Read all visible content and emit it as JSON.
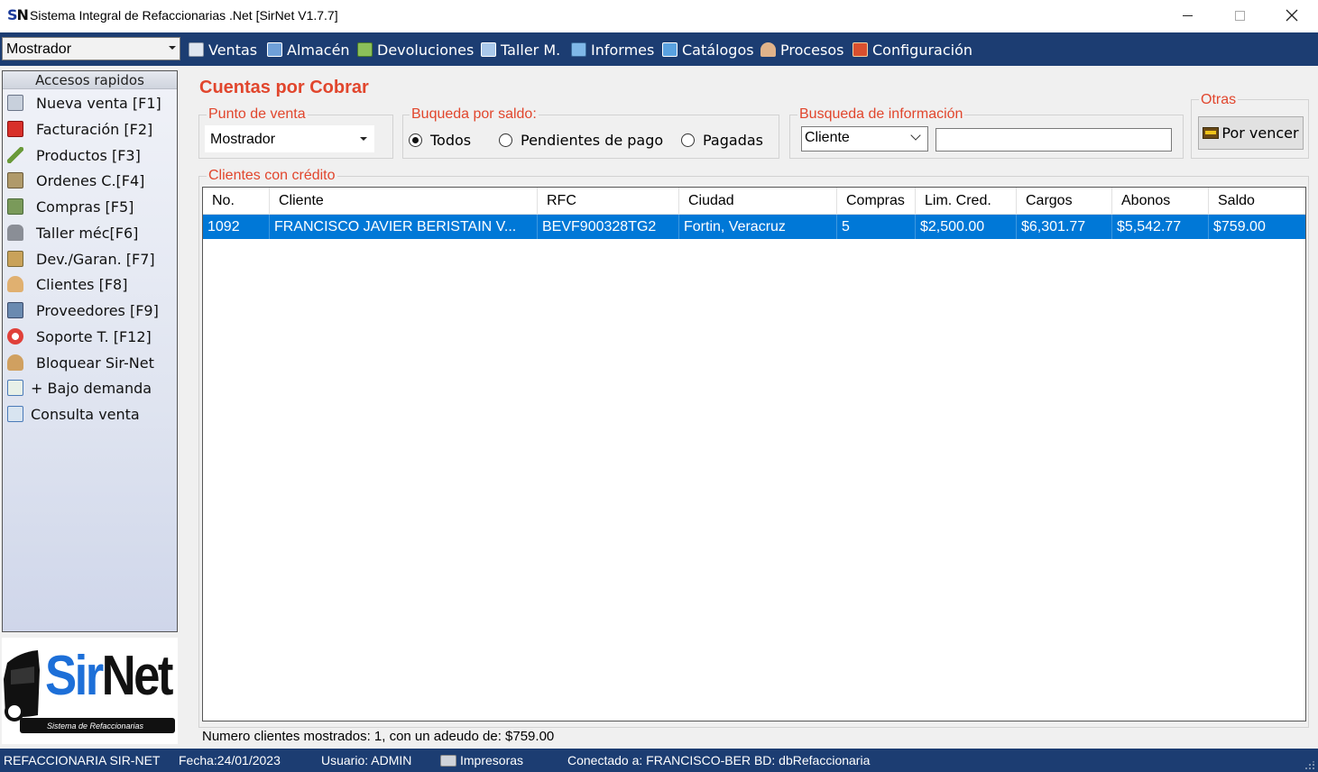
{
  "window": {
    "logo_s": "S",
    "logo_n": "N",
    "title": "Sistema Integral de Refaccionarias .Net [SirNet V1.7.7]"
  },
  "menubar": {
    "pos_select": "Mostrador",
    "items": [
      {
        "label": "Ventas",
        "icon": "ventas-icon",
        "color": "#dfe6f0"
      },
      {
        "label": "Almacén",
        "icon": "almacen-icon",
        "color": "#6fa0d8"
      },
      {
        "label": "Devoluciones",
        "icon": "devoluciones-icon",
        "color": "#8bbf5a"
      },
      {
        "label": "Taller M.",
        "icon": "taller-icon",
        "color": "#a9c8ea"
      },
      {
        "label": "Informes",
        "icon": "informes-icon",
        "color": "#7fb8e8"
      },
      {
        "label": "Catálogos",
        "icon": "catalogos-icon",
        "color": "#5aa2e0"
      },
      {
        "label": "Procesos",
        "icon": "procesos-icon",
        "color": "#e0b38a"
      },
      {
        "label": "Configuración",
        "icon": "configuracion-icon",
        "color": "#d9502f"
      }
    ]
  },
  "sidebar": {
    "header": "Accesos rapidos",
    "items": [
      {
        "label": "Nueva venta [F1]",
        "icon": "nueva-venta-icon",
        "color": "#c8d0dc"
      },
      {
        "label": "Facturación [F2]",
        "icon": "pdf-icon",
        "color": "#d8302a"
      },
      {
        "label": "Productos [F3]",
        "icon": "productos-icon",
        "color": "#6a9a3a"
      },
      {
        "label": "Ordenes C.[F4]",
        "icon": "ordenes-icon",
        "color": "#b09a6a"
      },
      {
        "label": "Compras [F5]",
        "icon": "compras-icon",
        "color": "#7a9a5a"
      },
      {
        "label": "Taller méc[F6]",
        "icon": "taller-mec-icon",
        "color": "#8a8e96"
      },
      {
        "label": "Dev./Garan. [F7]",
        "icon": "devgaran-icon",
        "color": "#c9a25a"
      },
      {
        "label": "Clientes [F8]",
        "icon": "clientes-icon",
        "color": "#e0b070"
      },
      {
        "label": "Proveedores [F9]",
        "icon": "proveedores-icon",
        "color": "#6a8ab0"
      },
      {
        "label": "Soporte T. [F12]",
        "icon": "soporte-icon",
        "color": "#e0403a"
      },
      {
        "label": "Bloquear Sir-Net",
        "icon": "bloquear-icon",
        "color": "#d0a060"
      },
      {
        "label": "+ Bajo demanda",
        "icon": "bajo-demanda-icon",
        "color": "#4a9a4a"
      },
      {
        "label": "Consulta venta",
        "icon": "consulta-venta-icon",
        "color": "#4a7ab8"
      }
    ]
  },
  "logo": {
    "sir": "Sir",
    "net": "Net",
    "subtitle": "Sistema de Refaccionarias"
  },
  "main": {
    "title": "Cuentas por Cobrar",
    "punto_venta": {
      "title": "Punto de venta",
      "value": "Mostrador"
    },
    "saldo": {
      "title": "Buqueda por saldo:",
      "options": [
        {
          "label": "Todos",
          "checked": true
        },
        {
          "label": "Pendientes de pago",
          "checked": false
        },
        {
          "label": "Pagadas",
          "checked": false
        }
      ]
    },
    "info": {
      "title": "Busqueda de información",
      "field": "Cliente",
      "query": ""
    },
    "otras": {
      "title": "Otras",
      "button": "Por vencer"
    },
    "clientes": {
      "title": "Clientes con crédito",
      "columns": [
        "No.",
        "Cliente",
        "RFC",
        "Ciudad",
        "Compras",
        "Lim. Cred.",
        "Cargos",
        "Abonos",
        "Saldo"
      ],
      "rows": [
        [
          "1092",
          "FRANCISCO JAVIER BERISTAIN V...",
          "BEVF900328TG2",
          "Fortin, Veracruz",
          "5",
          "$2,500.00",
          "$6,301.77",
          "$5,542.77",
          "$759.00"
        ]
      ]
    },
    "footer": "Numero clientes mostrados: 1, con un adeudo de: $759.00"
  },
  "statusbar": {
    "company": "REFACCIONARIA SIR-NET",
    "fecha": "Fecha:24/01/2023",
    "usuario": "Usuario: ADMIN",
    "impresoras": "Impresoras",
    "conectado": "Conectado a: FRANCISCO-BER BD: dbRefaccionaria"
  },
  "colors": {
    "accent_title": "#e1462d",
    "menubar": "#1c3d72",
    "selection": "#0078d7"
  }
}
